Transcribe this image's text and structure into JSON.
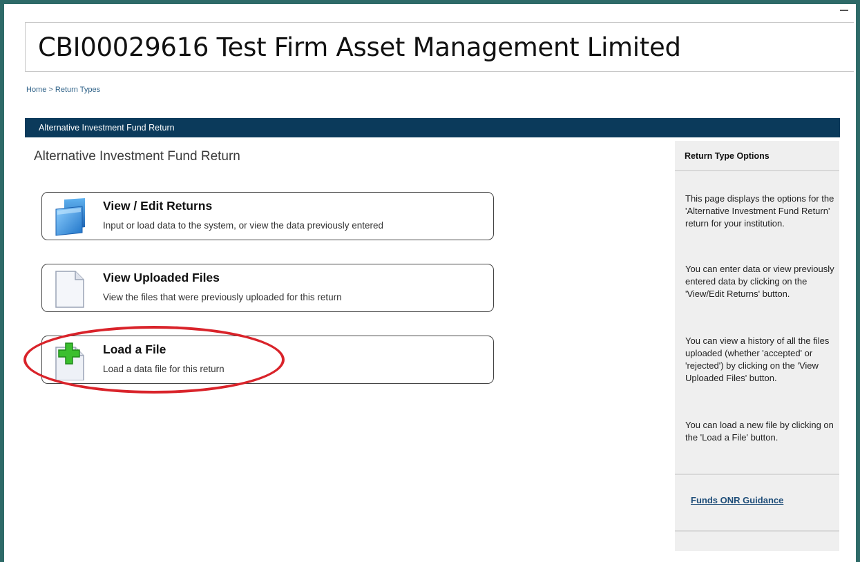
{
  "header": {
    "title": "CBI00029616 Test Firm Asset Management Limited"
  },
  "breadcrumb": {
    "home": "Home",
    "separator": " > ",
    "current": "Return Types"
  },
  "banner": {
    "label": "Alternative Investment Fund Return"
  },
  "main": {
    "heading": "Alternative Investment Fund Return",
    "options": [
      {
        "title": "View / Edit Returns",
        "description": "Input or load data to the system, or view the data previously entered",
        "icon": "folder-icon"
      },
      {
        "title": "View Uploaded Files",
        "description": "View the files that were previously uploaded for this return",
        "icon": "document-icon"
      },
      {
        "title": "Load a File",
        "description": "Load a data file for this return",
        "icon": "add-file-icon"
      }
    ]
  },
  "sidebar": {
    "title": "Return Type Options",
    "paragraphs": [
      "This page displays the options for the 'Alternative Investment Fund Return' return for your institution.",
      "You can enter data or view previously entered data by clicking on the 'View/Edit Returns' button.",
      "You can view a history of all the files uploaded (whether 'accepted' or 'rejected') by clicking on the 'View Uploaded Files' button.",
      "You can load a new file by clicking on the 'Load a File' button."
    ],
    "guidance_link": "Funds ONR Guidance"
  },
  "colors": {
    "frame": "#2e6a68",
    "banner": "#0b3a5b",
    "highlight": "#d9232a",
    "sidebar_bg": "#efefef"
  }
}
